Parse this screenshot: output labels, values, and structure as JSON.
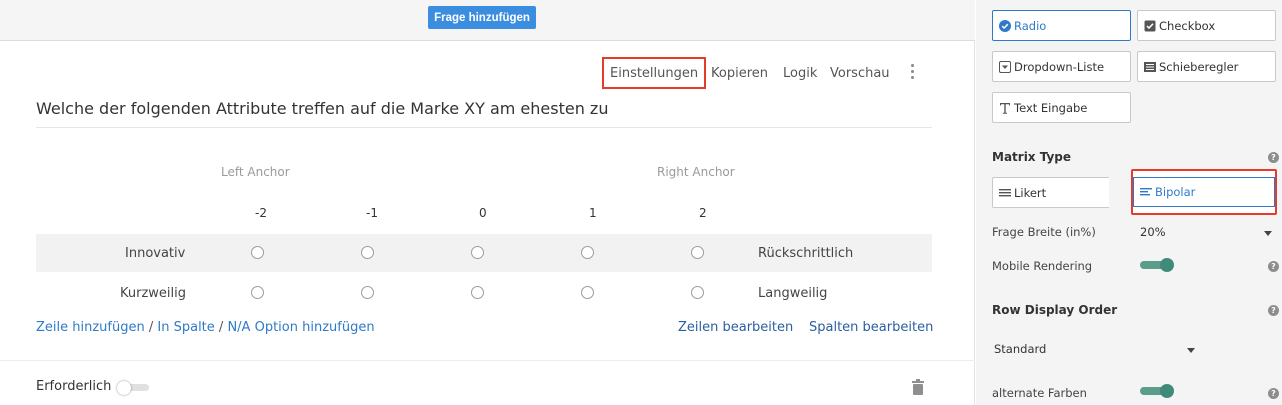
{
  "topbar": {
    "add_question": "Frage hinzufügen"
  },
  "toolbar": {
    "settings": "Einstellungen",
    "copy": "Kopieren",
    "logic": "Logik",
    "preview": "Vorschau"
  },
  "question": {
    "title": "Welche der folgenden Attribute treffen auf die Marke XY am ehesten zu",
    "left_anchor": "Left Anchor",
    "right_anchor": "Right Anchor",
    "scale": [
      "-2",
      "-1",
      "0",
      "1",
      "2"
    ],
    "rows": [
      {
        "left": "Innovativ",
        "right": "Rückschrittlich"
      },
      {
        "left": "Kurzweilig",
        "right": "Langweilig"
      }
    ]
  },
  "links": {
    "add_row": "Zeile hinzufügen",
    "slash": "/",
    "in_column": "In Spalte",
    "na_option": "N/A Option hinzufügen",
    "edit_rows": "Zeilen bearbeiten",
    "edit_columns": "Spalten bearbeiten"
  },
  "footer": {
    "required_label": "Erforderlich",
    "required_on": false
  },
  "panel": {
    "types": {
      "radio": "Radio",
      "checkbox": "Checkbox",
      "dropdown": "Dropdown-Liste",
      "slider": "Schieberegler",
      "text": "Text Eingabe"
    },
    "matrix_type": {
      "title": "Matrix Type",
      "likert": "Likert",
      "bipolar": "Bipolar"
    },
    "question_width": {
      "label": "Frage Breite (in%)",
      "value": "20%"
    },
    "mobile_rendering": {
      "label": "Mobile Rendering",
      "on": true
    },
    "row_display_order": {
      "title": "Row Display Order",
      "value": "Standard"
    },
    "alternate_colors": {
      "label": "alternate Farben",
      "on": true
    },
    "help_glyph": "?"
  },
  "colors": {
    "accent": "#3b8de0",
    "link": "#2f7ac8",
    "highlight": "#e53b2c",
    "toggle_on": "#3f8a78"
  }
}
